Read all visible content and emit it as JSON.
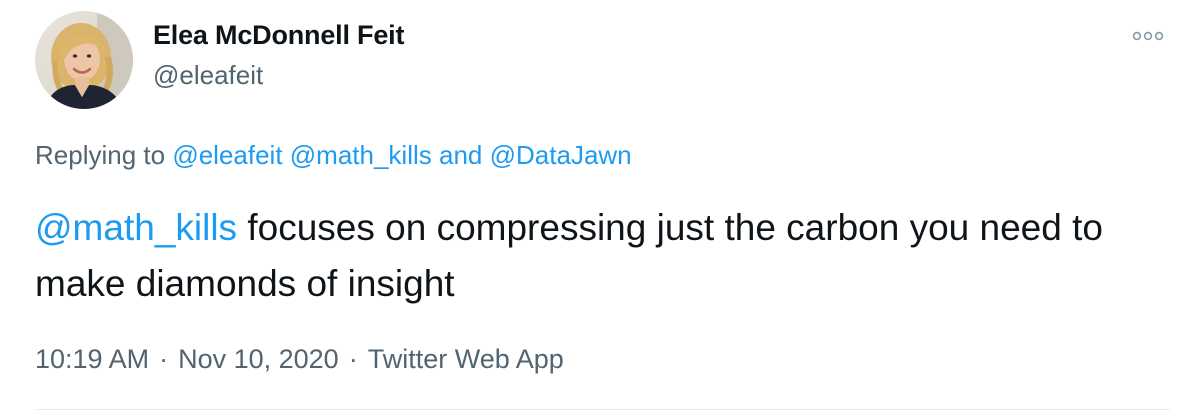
{
  "author": {
    "name": "Elea McDonnell Feit",
    "handle": "@eleafeit",
    "avatar_icon": "user-avatar-photo"
  },
  "more_icon": "more-horizontal-icon",
  "replying": {
    "prefix": "Replying to",
    "mention1": "@eleafeit",
    "mention2": "@math_kills",
    "conjunction": "and",
    "mention3": "@DataJawn"
  },
  "tweet": {
    "mention": "@math_kills",
    "text": "focuses on compressing just the carbon you need to make diamonds of insight"
  },
  "meta": {
    "time": "10:19 AM",
    "separator": "·",
    "date": "Nov 10, 2020",
    "source": "Twitter Web App"
  },
  "colors": {
    "link": "#1d9bf0",
    "secondary_text": "#536471",
    "primary_text": "#0f1419",
    "divider": "#e6ecf0"
  }
}
